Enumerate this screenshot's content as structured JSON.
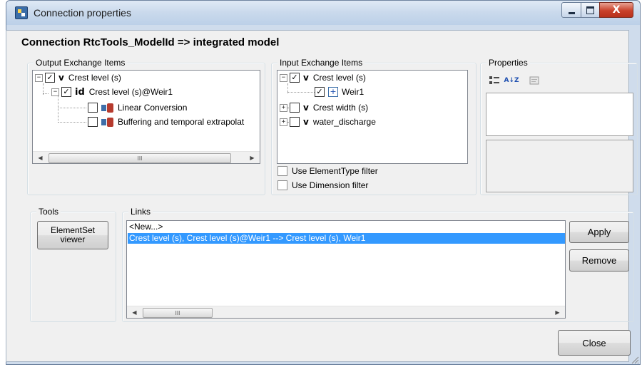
{
  "window": {
    "title": "Connection properties",
    "icon": "connection-app-icon",
    "controls": {
      "minimize": "minimize-icon",
      "maximize": "maximize-icon",
      "close_glyph": "X"
    }
  },
  "connection_title": "Connection RtcTools_ModelId => integrated model",
  "output_group": {
    "legend": "Output Exchange Items",
    "tree": [
      {
        "expander": "−",
        "checked": true,
        "tag": "v",
        "label": "Crest level (s)"
      },
      {
        "expander": "−",
        "checked": true,
        "tag": "id",
        "label": "Crest level (s)@Weir1"
      },
      {
        "checked": false,
        "icon": "conversion-icon",
        "label": "Linear Conversion"
      },
      {
        "checked": false,
        "icon": "conversion-icon",
        "label": "Buffering and temporal extrapolat"
      }
    ],
    "scroll_grip": "III"
  },
  "input_group": {
    "legend": "Input Exchange Items",
    "tree": [
      {
        "expander": "−",
        "checked": true,
        "tag": "v",
        "label": "Crest level (s)"
      },
      {
        "checked": true,
        "icon": "element-plus-icon",
        "label": "Weir1"
      },
      {
        "expander": "+",
        "checked": false,
        "tag": "v",
        "label": "Crest width (s)"
      },
      {
        "expander": "+",
        "checked": false,
        "tag": "v",
        "label": "water_discharge"
      }
    ],
    "filters": [
      {
        "label": "Use ElementType filter",
        "checked": false
      },
      {
        "label": "Use Dimension filter",
        "checked": false
      }
    ]
  },
  "properties_group": {
    "legend": "Properties",
    "toolbar": [
      "categorized-icon",
      "alphabetical-sort-icon",
      "property-pages-icon"
    ],
    "sort_glyph": "A↓Z"
  },
  "tools_group": {
    "legend": "Tools",
    "elementset_button": "ElementSet viewer"
  },
  "links_group": {
    "legend": "Links",
    "items": [
      {
        "label": "<New...>",
        "selected": false
      },
      {
        "label": "Crest level (s), Crest level (s)@Weir1 --> Crest level (s), Weir1",
        "selected": true
      }
    ],
    "scroll_grip": "III"
  },
  "buttons": {
    "apply": "Apply",
    "remove": "Remove",
    "close": "Close"
  },
  "colors": {
    "selection": "#3399ff",
    "client_bg": "#f0f0f0",
    "titlebar": "#c9d9ec",
    "close_button": "#c9412a"
  }
}
